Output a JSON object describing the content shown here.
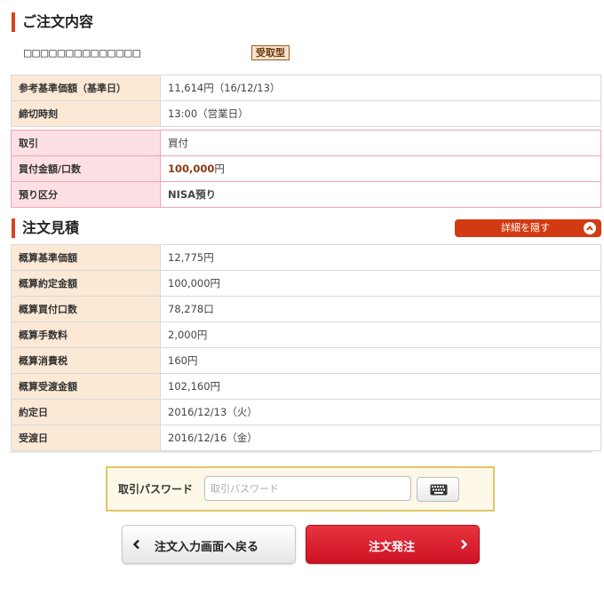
{
  "order_section": {
    "title": "ご注文内容",
    "fund_name": "□□□□□□□□□□□□□□",
    "fund_badge": "受取型"
  },
  "reference_rows": [
    {
      "label": "参考基準価額（基準日）",
      "value": "11,614円（16/12/13）"
    },
    {
      "label": "締切時刻",
      "value": "13:00（営業日）"
    }
  ],
  "trade_rows": {
    "trade": {
      "label": "取引",
      "value": "買付"
    },
    "amount": {
      "label": "買付金額/口数",
      "value_number": "100,000",
      "value_unit": "円"
    },
    "account": {
      "label": "預り区分",
      "value": "NISA預り"
    }
  },
  "estimate_section": {
    "title": "注文見積",
    "toggle_label": "詳細を隠す",
    "rows": [
      {
        "label": "概算基準価額",
        "value": "12,775円"
      },
      {
        "label": "概算約定金額",
        "value": "100,000円"
      },
      {
        "label": "概算買付口数",
        "value": "78,278口"
      },
      {
        "label": "概算手数料",
        "value": "2,000円"
      },
      {
        "label": "概算消費税",
        "value": "160円"
      },
      {
        "label": "概算受渡金額",
        "value": "102,160円"
      },
      {
        "label": "約定日",
        "value": "2016/12/13（火）"
      },
      {
        "label": "受渡日",
        "value": "2016/12/16（金）"
      }
    ]
  },
  "password": {
    "label": "取引パスワード",
    "value": "",
    "placeholder": "取引パスワード"
  },
  "buttons": {
    "back_label": "注文入力画面へ戻る",
    "submit_label": "注文発注"
  },
  "colors": {
    "accent": "#d9431f",
    "submit": "#d91c2c",
    "label_bg": "#fbe9d6",
    "pink_label_bg": "#fde0e4"
  },
  "icons": {
    "toggle": "chevron-up-icon",
    "keyboard": "keyboard-icon",
    "back": "chevron-left-icon",
    "submit": "chevron-right-icon"
  }
}
